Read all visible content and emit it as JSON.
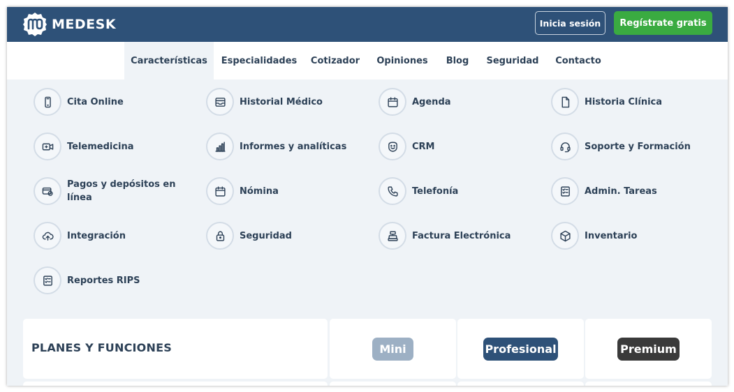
{
  "header": {
    "logo_text": "MEDESK",
    "login_label": "Inicia sesión",
    "register_label": "Regístrate gratis"
  },
  "nav": {
    "tabs": [
      {
        "label": "Características",
        "active": true
      },
      {
        "label": "Especialidades"
      },
      {
        "label": "Cotizador"
      },
      {
        "label": "Opiniones"
      },
      {
        "label": "Blog"
      },
      {
        "label": "Seguridad"
      },
      {
        "label": "Contacto"
      }
    ]
  },
  "features": [
    {
      "label": "Cita Online",
      "icon": "phone-mobile-icon"
    },
    {
      "label": "Historial Médico",
      "icon": "inbox-icon"
    },
    {
      "label": "Agenda",
      "icon": "calendar-icon"
    },
    {
      "label": "Historia Clínica",
      "icon": "document-icon"
    },
    {
      "label": "Telemedicina",
      "icon": "video-camera-icon"
    },
    {
      "label": "Informes y analíticas",
      "icon": "bar-chart-icon"
    },
    {
      "label": "CRM",
      "icon": "smiley-badge-icon"
    },
    {
      "label": "Soporte y Formación",
      "icon": "headset-icon"
    },
    {
      "label": "Pagos y depósitos en línea",
      "icon": "payment-icon"
    },
    {
      "label": "Nómina",
      "icon": "calendar-icon"
    },
    {
      "label": "Telefonía",
      "icon": "phone-icon"
    },
    {
      "label": "Admin. Tareas",
      "icon": "checklist-icon"
    },
    {
      "label": "Integración",
      "icon": "cloud-upload-icon"
    },
    {
      "label": "Seguridad",
      "icon": "lock-icon"
    },
    {
      "label": "Factura Electrónica",
      "icon": "cash-register-icon"
    },
    {
      "label": "Inventario",
      "icon": "box-icon"
    },
    {
      "label": "Reportes RIPS",
      "icon": "checklist-icon"
    }
  ],
  "plans": {
    "title": "PLANES Y FUNCIONES",
    "items": [
      {
        "label": "Mini",
        "color": "#9db0c4"
      },
      {
        "label": "Profesional",
        "color": "#2e5178"
      },
      {
        "label": "Premium",
        "color": "#3a3a3a"
      }
    ]
  },
  "colors": {
    "header_bg": "#2e5178",
    "register_green": "#3aab41",
    "page_bg": "#eff3f7",
    "text_dark": "#2d4157"
  }
}
